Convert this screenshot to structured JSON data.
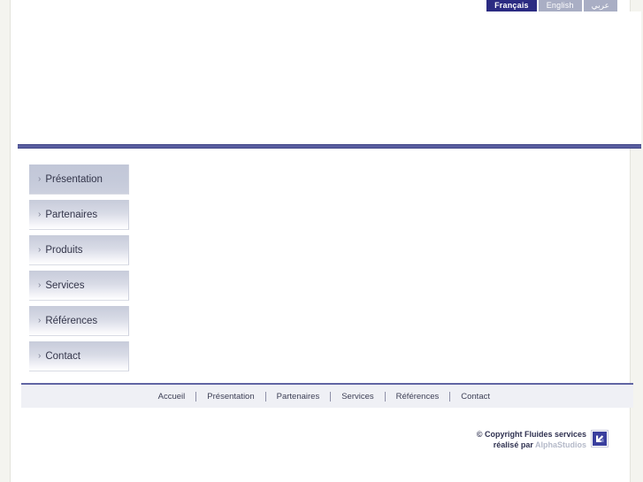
{
  "site": {
    "name": "Fluides services"
  },
  "language_bar": {
    "options": [
      {
        "label": "Français",
        "code": "fr",
        "active": true
      },
      {
        "label": "English",
        "code": "en",
        "active": false
      },
      {
        "label": "عربي",
        "code": "ar",
        "active": false
      }
    ]
  },
  "header": {
    "banner_alt": ""
  },
  "sidebar": {
    "arrow_icon": "›",
    "items": [
      {
        "label": "Présentation",
        "selected": true
      },
      {
        "label": "Partenaires",
        "selected": false
      },
      {
        "label": "Produits",
        "selected": false
      },
      {
        "label": "Services",
        "selected": false
      },
      {
        "label": "Références",
        "selected": false
      },
      {
        "label": "Contact",
        "selected": false
      }
    ]
  },
  "footer": {
    "links": [
      {
        "label": "Accueil"
      },
      {
        "label": "Présentation"
      },
      {
        "label": "Partenaires"
      },
      {
        "label": "Services"
      },
      {
        "label": "Références"
      },
      {
        "label": "Contact"
      }
    ],
    "copyright_line1": "© Copyright Fluides services",
    "credit_prefix": "réalisé par ",
    "credit_studio": "AlphaStudios"
  },
  "colors": {
    "accent_blue": "#5a5fa0",
    "active_lang": "#2b2b82",
    "inactive_lang": "#a9aec4",
    "nav_gradient_top": "#c7cbda",
    "footer_bg": "#eff0f5",
    "page_surround": "#f4f4ef"
  }
}
